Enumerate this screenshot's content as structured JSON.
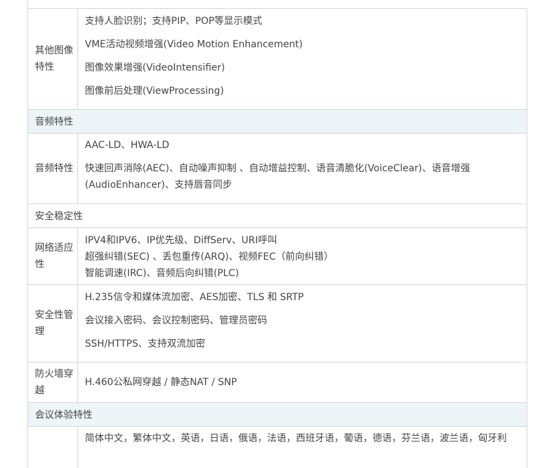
{
  "table": {
    "image": {
      "label": "其他图像特性",
      "items": [
        "支持人脸识别；支持PIP、POP等显示模式",
        "VME活动视频增强(Video Motion Enhancement)",
        "图像效果增强(VideoIntensifier)",
        "图像前后处理(ViewProcessing)"
      ]
    },
    "audio_section": "音频特性",
    "audio": {
      "label": "音频特性",
      "item1": "AAC-LD、HWA-LD",
      "item2_line1": "快速回声消除(AEC)、自动噪声抑制 、自动增益控制、语音清脆化(VoiceClear)、语音增强",
      "item2_line2": "(AudioEnhancer)、支持唇音同步"
    },
    "security_section": "安全稳定性",
    "network": {
      "label": "网络适应性",
      "items": [
        "IPV4和IPV6、IP优先级、DiffServ、URI呼叫",
        "超强纠错(SEC) 、丢包重传(ARQ)、视频FEC（前向纠错）",
        "智能调速(IRC)、音频后向纠错(PLC)"
      ]
    },
    "safety": {
      "label": "安全性管理",
      "items": [
        "H.235信令和媒体流加密、AES加密、TLS 和 SRTP",
        "会议接入密码、会议控制密码、管理员密码",
        "SSH/HTTPS、支持双流加密"
      ]
    },
    "firewall": {
      "label": "防火墙穿越",
      "item": "H.460公私网穿越 / 静态NAT / SNP"
    },
    "conference_section": "会议体验特性",
    "languages": {
      "item": "简体中文，繁体中文，英语，日语，俄语，法语，西班牙语，葡语，德语，芬兰语，波兰语，匈牙利"
    }
  }
}
